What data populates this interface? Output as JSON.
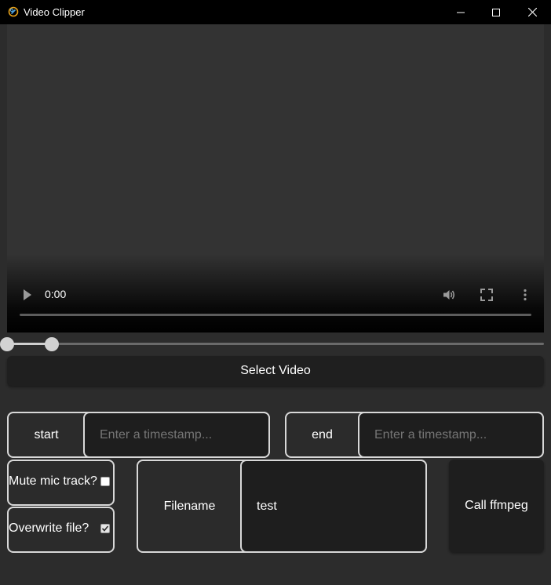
{
  "window": {
    "title": "Video Clipper",
    "icon": "app-chain-icon",
    "controls": [
      "minimize-icon",
      "maximize-icon",
      "close-icon"
    ]
  },
  "video_player": {
    "time": "0:00",
    "controls": [
      "play-icon",
      "volume-icon",
      "fullscreen-icon",
      "more-options-icon"
    ]
  },
  "range_slider": {
    "low": 0,
    "high": 0.083
  },
  "select_video": {
    "label": "Select Video"
  },
  "start": {
    "label": "start",
    "placeholder": "Enter a timestamp...",
    "value": ""
  },
  "end": {
    "label": "end",
    "placeholder": "Enter a timestamp...",
    "value": ""
  },
  "mute": {
    "label": "Mute mic track?",
    "checked": false
  },
  "overwrite": {
    "label": "Overwrite file?",
    "checked": true
  },
  "filename": {
    "label": "Filename",
    "value": "test"
  },
  "ffmpeg": {
    "label": "Call ffmpeg"
  },
  "colors": {
    "background": "#2c2c2c",
    "titlebar": "#000000",
    "button": "#1f1f1f",
    "border": "#d8d8d8",
    "placeholder": "#8a8a8a"
  }
}
